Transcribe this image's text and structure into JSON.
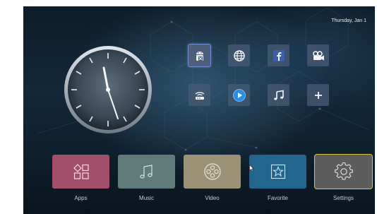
{
  "status_bar": {
    "date": "Thursday, Jan 1"
  },
  "clock": {
    "hour": 11,
    "minute": 27
  },
  "shortcuts": [
    {
      "icon": "android-apk-icon",
      "selected": true
    },
    {
      "icon": "globe-icon"
    },
    {
      "icon": "facebook-icon"
    },
    {
      "icon": "movie-camera-icon"
    },
    {
      "icon": "wifi-router-icon"
    },
    {
      "icon": "play-circle-icon"
    },
    {
      "icon": "music-note-icon"
    },
    {
      "icon": "plus-icon"
    }
  ],
  "dock": [
    {
      "label": "Apps",
      "icon": "apps-grid-icon",
      "color": "#a24f6b"
    },
    {
      "label": "Music",
      "icon": "music-note-icon",
      "color": "#5e7b7a"
    },
    {
      "label": "Video",
      "icon": "film-reel-icon",
      "color": "#9a9176"
    },
    {
      "label": "Favorite",
      "icon": "star-icon",
      "color": "#22658d"
    },
    {
      "label": "Settings",
      "icon": "gear-icon",
      "color": "#5d5d5e",
      "focused": true
    }
  ],
  "colors": {
    "focus_border": "#d8c93a",
    "tile_bg": "#465a73"
  }
}
